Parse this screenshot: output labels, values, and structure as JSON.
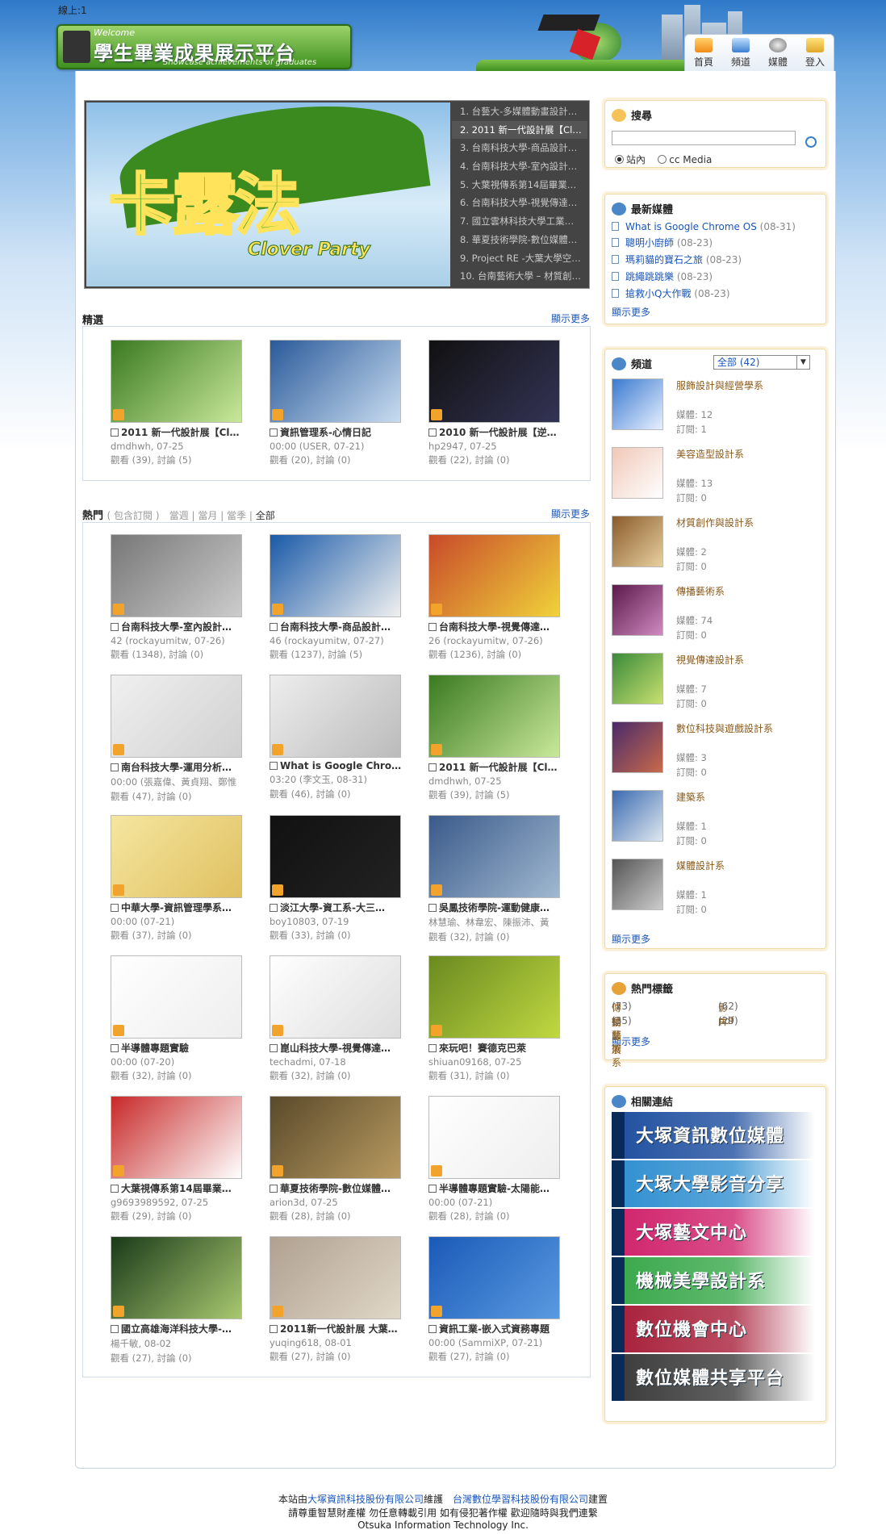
{
  "header": {
    "online": "線上:1",
    "logo_welcome": "Welcome",
    "logo_title": "學生畢業成果展示平台",
    "logo_subtitle": "Showcase achievements of graduates",
    "nav": [
      {
        "label": "首頁",
        "icon": "home-icon"
      },
      {
        "label": "頻道",
        "icon": "monitor-icon"
      },
      {
        "label": "媒體",
        "icon": "film-reel-icon"
      },
      {
        "label": "登入",
        "icon": "lock-icon"
      }
    ]
  },
  "slider": {
    "image_text": "卡露法",
    "image_text_en": "Clover Party",
    "items": [
      "1. 台藝大-多媒體動畫設計…",
      "2. 2011 新一代設計展【Cl…",
      "3. 台南科技大學-商品設計…",
      "4. 台南科技大學-室內設計…",
      "5. 大葉視傳系第14屆畢業…",
      "6. 台南科技大學-視覺傳達…",
      "7. 國立雲林科技大學工業…",
      "8. 華夏技術學院-數位媒體…",
      "9. Project RE -大葉大學空…",
      "10. 台南藝術大學 – 材質創…"
    ],
    "active_index": 1
  },
  "featured": {
    "title": "精選",
    "more": "顯示更多",
    "items": [
      {
        "title": "2011 新一代設計展【Cl…",
        "meta": "dmdhwh, 07-25",
        "stats": "觀看 (39), 討論 (5)"
      },
      {
        "title": "資訊管理系-心情日記",
        "meta": "00:00 (USER, 07-21)",
        "stats": "觀看 (20), 討論 (0)"
      },
      {
        "title": "2010 新一代設計展【逆…",
        "meta": "hp2947, 07-25",
        "stats": "觀看 (22), 討論 (0)"
      }
    ]
  },
  "popular": {
    "title": "熱門",
    "subscribed": "( 包含訂閱 )",
    "filters": [
      "當週",
      "當月",
      "當季"
    ],
    "filter_all": "全部",
    "more": "顯示更多",
    "items": [
      {
        "title": "台南科技大學-室內設計…",
        "meta": "42 (rockayumitw, 07-26)",
        "stats": "觀看 (1348), 討論 (0)"
      },
      {
        "title": "台南科技大學-商品設計…",
        "meta": "46 (rockayumitw, 07-27)",
        "stats": "觀看 (1237), 討論 (5)"
      },
      {
        "title": "台南科技大學-視覺傳達…",
        "meta": "26 (rockayumitw, 07-26)",
        "stats": "觀看 (1236), 討論 (0)"
      },
      {
        "title": "南台科技大學-運用分析…",
        "meta": "00:00 (張嘉偉、黃貞翔、鄭惟",
        "stats": "觀看 (47), 討論 (0)"
      },
      {
        "title": "What is Google Chrome…",
        "meta": "03:20 (李文玉, 08-31)",
        "stats": "觀看 (46), 討論 (0)"
      },
      {
        "title": "2011 新一代設計展【Cl…",
        "meta": "dmdhwh, 07-25",
        "stats": "觀看 (39), 討論 (5)"
      },
      {
        "title": "中華大學-資訊管理學系…",
        "meta": "00:00 (07-21)",
        "stats": "觀看 (37), 討論 (0)"
      },
      {
        "title": "淡江大學-資工系-大三…",
        "meta": "boy10803, 07-19",
        "stats": "觀看 (33), 討論 (0)"
      },
      {
        "title": "吳鳳技術學院-運動健康…",
        "meta": "林慧瑜、林韋宏、陳振沛、黃",
        "stats": "觀看 (32), 討論 (0)"
      },
      {
        "title": "半導體專題實驗",
        "meta": "00:00 (07-20)",
        "stats": "觀看 (32), 討論 (0)"
      },
      {
        "title": "崑山科技大學-視覺傳達…",
        "meta": "techadmi, 07-18",
        "stats": "觀看 (32), 討論 (0)"
      },
      {
        "title": "來玩吧！賽德克巴萊",
        "meta": "shiuan09168, 07-25",
        "stats": "觀看 (31), 討論 (0)"
      },
      {
        "title": "大葉視傳系第14屆畢業…",
        "meta": "g9693989592, 07-25",
        "stats": "觀看 (29), 討論 (0)"
      },
      {
        "title": "華夏技術學院-數位媒體…",
        "meta": "arion3d, 07-25",
        "stats": "觀看 (28), 討論 (0)"
      },
      {
        "title": "半導體專題實驗-太陽能…",
        "meta": "00:00 (07-21)",
        "stats": "觀看 (28), 討論 (0)"
      },
      {
        "title": "國立高雄海洋科技大學-…",
        "meta": "楊千敏, 08-02",
        "stats": "觀看 (27), 討論 (0)"
      },
      {
        "title": "2011新一代設計展 大葉…",
        "meta": "yuqing618, 08-01",
        "stats": "觀看 (27), 討論 (0)"
      },
      {
        "title": "資訊工業-嵌入式資務專題",
        "meta": "00:00 (SammiXP, 07-21)",
        "stats": "觀看 (27), 討論 (0)"
      }
    ]
  },
  "search": {
    "title": "搜尋",
    "opt_site": "站內",
    "opt_cc": "cc Media"
  },
  "latest": {
    "title": "最新媒體",
    "more": "顯示更多",
    "items": [
      {
        "name": "What is Google Chrome OS",
        "date": "(08-31)"
      },
      {
        "name": "聰明小廚師",
        "date": "(08-23)"
      },
      {
        "name": "瑪莉貓的寶石之旅",
        "date": "(08-23)"
      },
      {
        "name": "跳繩跳跳樂",
        "date": "(08-23)"
      },
      {
        "name": "搶救小Q大作戰",
        "date": "(08-23)"
      }
    ]
  },
  "channels": {
    "title": "頻道",
    "select": "全部 (42)",
    "more": "顯示更多",
    "items": [
      {
        "name": "服飾設計與經營學系",
        "media": "媒體: 12",
        "subs": "訂閱: 1"
      },
      {
        "name": "美容造型設計系",
        "media": "媒體: 13",
        "subs": "訂閱: 0"
      },
      {
        "name": "材質創作與設計系",
        "media": "媒體: 2",
        "subs": "訂閱: 0"
      },
      {
        "name": "傳播藝術系",
        "media": "媒體: 74",
        "subs": "訂閱: 0"
      },
      {
        "name": "視覺傳達設計系",
        "media": "媒體: 7",
        "subs": "訂閱: 0"
      },
      {
        "name": "數位科技與遊戲設計系",
        "media": "媒體: 3",
        "subs": "訂閱: 0"
      },
      {
        "name": "建築系",
        "media": "媒體: 1",
        "subs": "訂閱: 0"
      },
      {
        "name": "媒體設計系",
        "media": "媒體: 1",
        "subs": "訂閱: 0"
      }
    ]
  },
  "tags": {
    "title": "熱門標籤",
    "more": "顯示更多",
    "items": [
      {
        "name": "傳播藝術系",
        "count": "(73)"
      },
      {
        "name": "影片",
        "count": "(62)"
      },
      {
        "name": "動態展",
        "count": "(35)"
      },
      {
        "name": "pdf",
        "count": "(29)"
      }
    ]
  },
  "links": {
    "title": "相關連結",
    "items": [
      "大塚資訊數位媒體",
      "大塚大學影音分享",
      "大塚藝文中心",
      "機械美學設計系",
      "數位機會中心",
      "數位媒體共享平台"
    ],
    "colors": [
      "#1f4f9f",
      "#2f8fd0",
      "#d0226b",
      "#38a84a",
      "#a81f3a",
      "#3a3a3a"
    ]
  },
  "footer": {
    "l1_pre": "本站由",
    "l1_link1": "大塚資訊科技股份有限公司",
    "l1_mid": "維護　",
    "l1_link2": "台灣數位學習科技股份有限公司",
    "l1_post": "建置",
    "l2": "請尊重智慧財產權 勿任意轉載引用 如有侵犯著作權 歡迎隨時與我們連繫",
    "l3": "Otsuka Information Technology Inc."
  }
}
